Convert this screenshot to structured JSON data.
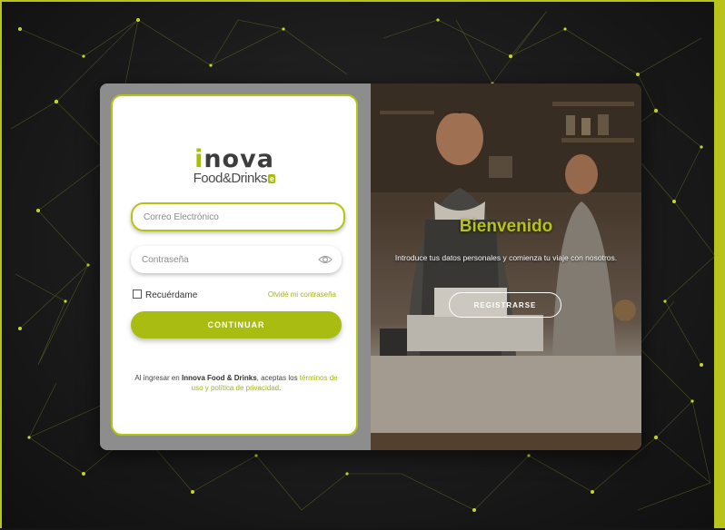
{
  "logo": {
    "brand_name": "nova",
    "brand_initial": "i",
    "sub_name": "Food&Drinks",
    "sub_badge": "e"
  },
  "login": {
    "email_placeholder": "Correo Electrónico",
    "password_placeholder": "Contraseña",
    "remember_label": "Recuérdame",
    "forgot_label": "Olvidé mi contraseña",
    "continue_label": "CONTINUAR",
    "terms_prefix": "Al ingresar en ",
    "terms_brand": "Innova Food & Drinks",
    "terms_middle": ", aceptas los ",
    "terms_link": "términos de uso y política de privacidad",
    "terms_suffix": "."
  },
  "welcome": {
    "title": "Bienvenido",
    "text": "Introduce tus datos personales y comienza tu viaje con nosotros.",
    "register_label": "REGISTRARSE"
  },
  "icons": {
    "password_toggle": "eye-icon"
  },
  "colors": {
    "accent": "#a9bc12",
    "frame_border": "#b8c41a",
    "background": "#151515"
  }
}
